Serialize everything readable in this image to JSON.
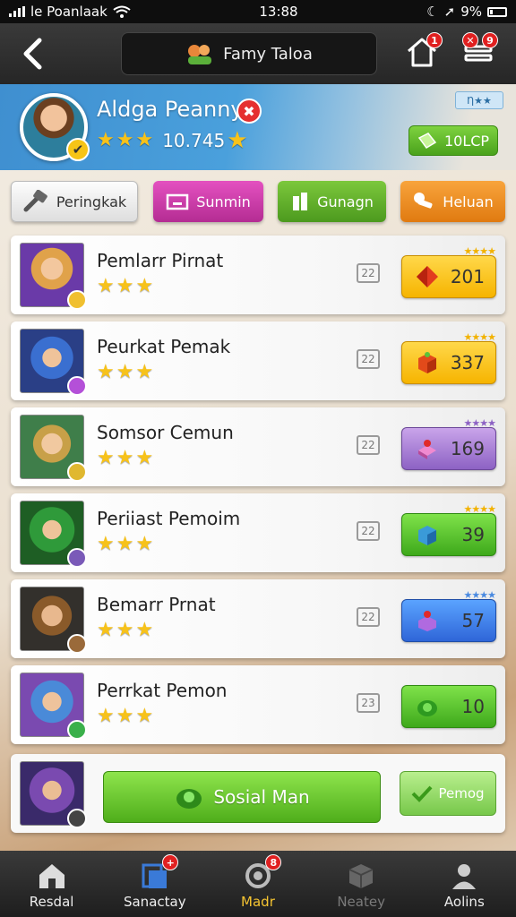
{
  "status_bar": {
    "carrier": "le Poanlaak",
    "time": "13:88",
    "battery": "9%"
  },
  "header": {
    "title": "Famy Taloa",
    "home_badge": "1",
    "menu_badge": "9"
  },
  "profile": {
    "name": "Aldga Peanny",
    "stars": 3,
    "score": "10.745",
    "tag": "Ƞ★★",
    "currency": "10LCP"
  },
  "tabs": [
    {
      "label": "Peringkak"
    },
    {
      "label": "Sunmin"
    },
    {
      "label": "Gunagn"
    },
    {
      "label": "Heluan"
    }
  ],
  "rows": [
    {
      "name": "Pemlarr Pirnat",
      "stars": 3,
      "level": "22",
      "value": "201",
      "reward_color": "yellow"
    },
    {
      "name": "Peurkat Pemak",
      "stars": 3,
      "level": "22",
      "value": "337",
      "reward_color": "yellow"
    },
    {
      "name": "Somsor Cemun",
      "stars": 3,
      "level": "22",
      "value": "169",
      "reward_color": "purple"
    },
    {
      "name": "Periiast Pemoim",
      "stars": 3,
      "level": "22",
      "value": "39",
      "reward_color": "green"
    },
    {
      "name": "Bemarr Prnat",
      "stars": 3,
      "level": "22",
      "value": "57",
      "reward_color": "blue"
    },
    {
      "name": "Perrkat Pemon",
      "stars": 3,
      "level": "23",
      "value": "10",
      "reward_color": "green"
    }
  ],
  "social": {
    "button": "Sosial Man",
    "secondary": "Pemog"
  },
  "nav": [
    {
      "label": "Resdal",
      "badge": ""
    },
    {
      "label": "Sanactay",
      "badge": "+"
    },
    {
      "label": "Madr",
      "badge": "8"
    },
    {
      "label": "Neatey",
      "badge": ""
    },
    {
      "label": "Aolins",
      "badge": ""
    }
  ],
  "colors": {
    "accent": "#f5c431",
    "header_blue": "#3f8fd0",
    "green": "#4fae1b"
  }
}
